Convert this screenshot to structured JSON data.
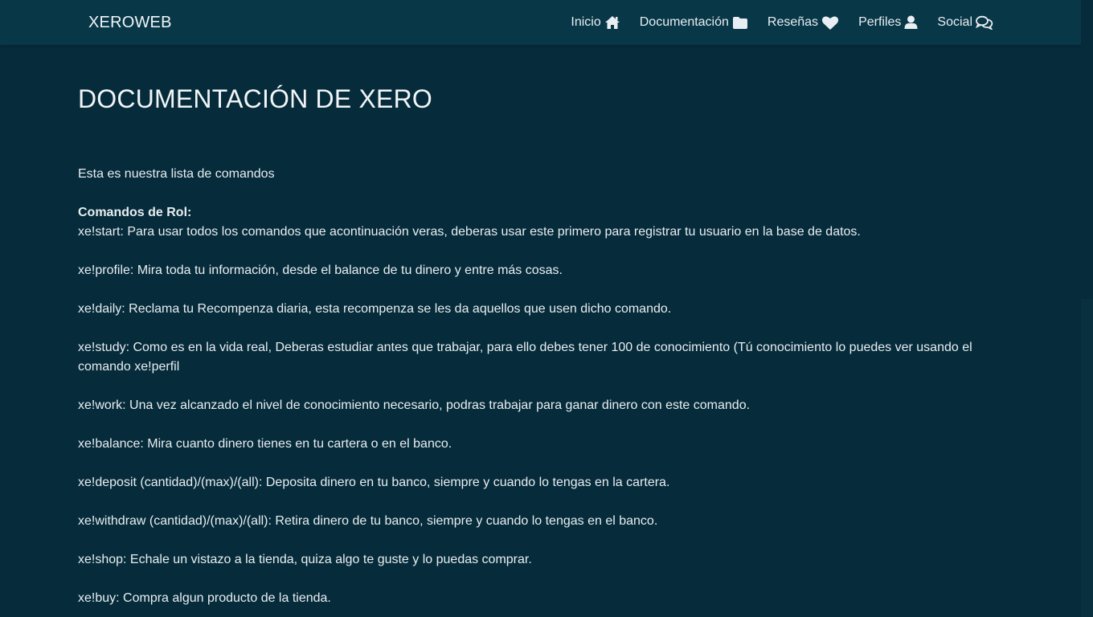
{
  "nav": {
    "brand": "XEROWEB",
    "items": [
      {
        "label": "Inicio",
        "icon": "home-icon"
      },
      {
        "label": "Documentación",
        "icon": "folder-icon"
      },
      {
        "label": "Reseñas",
        "icon": "heart-icon"
      },
      {
        "label": "Perfiles",
        "icon": "user-icon"
      },
      {
        "label": "Social",
        "icon": "comments-icon"
      }
    ]
  },
  "page": {
    "title": "DOCUMENTACIÓN DE XERO",
    "intro": "Esta es nuestra lista de comandos",
    "section_title": "Comandos de Rol:",
    "commands": [
      "xe!start: Para usar todos los comandos que acontinuación veras, deberas usar este primero para registrar tu usuario en la base de datos.",
      "xe!profile: Mira toda tu información, desde el balance de tu dinero y entre más cosas.",
      "xe!daily: Reclama tu Recompenza diaria, esta recompenza se les da aquellos que usen dicho comando.",
      "xe!study: Como es en la vida real, Deberas estudiar antes que trabajar, para ello debes tener 100 de conocimiento (Tú conocimiento lo puedes ver usando el comando xe!perfil",
      "xe!work: Una vez alcanzado el nivel de conocimiento necesario, podras trabajar para ganar dinero con este comando.",
      "xe!balance: Mira cuanto dinero tienes en tu cartera o en el banco.",
      "xe!deposit (cantidad)/(max)/(all): Deposita dinero en tu banco, siempre y cuando lo tengas en la cartera.",
      "xe!withdraw (cantidad)/(max)/(all): Retira dinero de tu banco, siempre y cuando lo tengas en el banco.",
      "xe!shop: Echale un vistazo a la tienda, quiza algo te guste y lo puedas comprar.",
      "xe!buy: Compra algun producto de la tienda."
    ]
  },
  "colors": {
    "background": "#062b3b",
    "navbar": "#083748",
    "text": "#e8eef1"
  }
}
